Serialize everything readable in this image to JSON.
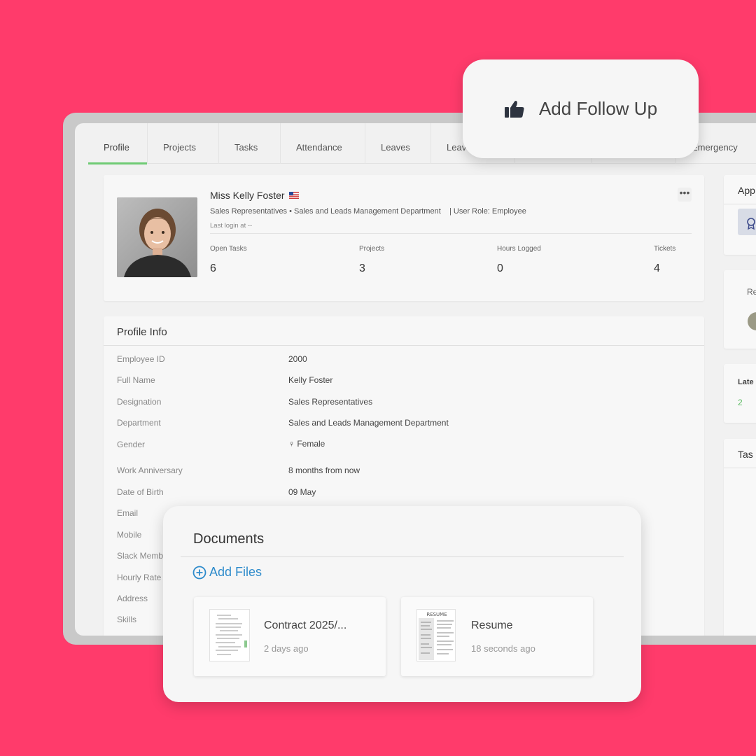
{
  "tabs": [
    "Profile",
    "Projects",
    "Tasks",
    "Attendance",
    "Leaves",
    "Leav",
    "Emergency"
  ],
  "profile": {
    "name": "Miss Kelly Foster",
    "subline": "Sales Representatives • Sales and Leads Management Department    | User Role: Employee",
    "last_login": "Last login at --",
    "more": "•••",
    "stats": [
      {
        "label": "Open Tasks",
        "value": "6"
      },
      {
        "label": "Projects",
        "value": "3"
      },
      {
        "label": "Hours Logged",
        "value": "0"
      },
      {
        "label": "Tickets",
        "value": "4"
      }
    ]
  },
  "profile_info": {
    "title": "Profile Info",
    "rows": [
      {
        "label": "Employee ID",
        "value": "2000"
      },
      {
        "label": "Full Name",
        "value": "Kelly Foster"
      },
      {
        "label": "Designation",
        "value": "Sales Representatives"
      },
      {
        "label": "Department",
        "value": "Sales and Leads Management Department"
      },
      {
        "label": "Gender",
        "value": "♀ Female"
      },
      {
        "label": "Work Anniversary",
        "value": "8 months from now"
      },
      {
        "label": "Date of Birth",
        "value": "09 May"
      },
      {
        "label": "Email",
        "value": ""
      },
      {
        "label": "Mobile",
        "value": ""
      },
      {
        "label": "Slack Memb",
        "value": ""
      },
      {
        "label": "Hourly Rate",
        "value": ""
      },
      {
        "label": "Address",
        "value": ""
      },
      {
        "label": "Skills",
        "value": ""
      }
    ]
  },
  "right_column": {
    "card1_title": "App",
    "card2_title": "Re",
    "card3_title": "Late",
    "card3_value": "2",
    "card4_title": "Tas"
  },
  "follow_up": {
    "label": "Add Follow Up",
    "icon": "thumbs-up-icon"
  },
  "documents": {
    "title": "Documents",
    "add_files": "Add Files",
    "files": [
      {
        "name": "Contract 2025/...",
        "time": "2 days ago"
      },
      {
        "name": "Resume",
        "time": "18 seconds ago",
        "thumb_label": "RESUME"
      }
    ]
  },
  "colors": {
    "background": "#FF3B6B",
    "accent_green": "#6FCB74",
    "link_blue": "#2E8BCB"
  }
}
